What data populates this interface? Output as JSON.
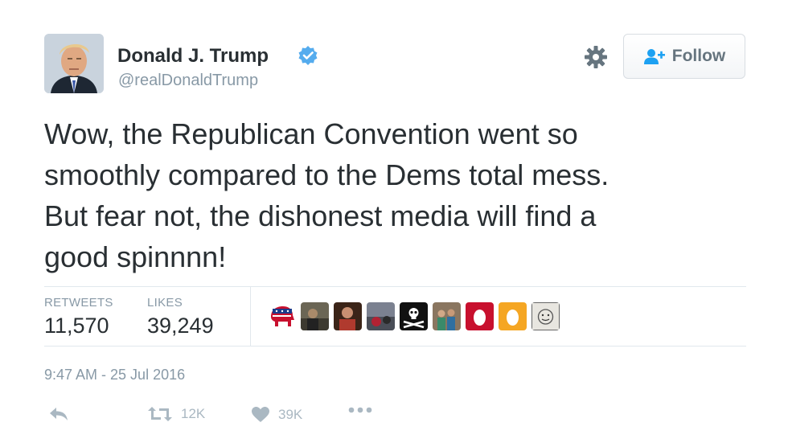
{
  "author": {
    "name": "Donald J. Trump",
    "handle": "@realDonaldTrump",
    "verified": true
  },
  "follow_button": {
    "label": "Follow"
  },
  "tweet": {
    "lines": [
      "Wow, the Republican Convention went so",
      "smoothly compared to the Dems total mess.",
      "But fear not, the dishonest media will find a",
      "good spinnnn!"
    ]
  },
  "stats": {
    "retweets_label": "RETWEETS",
    "retweets_count": "11,570",
    "likes_label": "LIKES",
    "likes_count": "39,249"
  },
  "liker_avatars": [
    "republican-elephant",
    "photo",
    "photo",
    "photo",
    "pirate-flag",
    "photo",
    "default-egg-red",
    "default-egg-orange",
    "sketch"
  ],
  "timestamp": "9:47 AM - 25 Jul 2016",
  "actions": {
    "retweet_count": "12K",
    "like_count": "39K"
  },
  "colors": {
    "text": "#292f33",
    "muted": "#8899a6",
    "verified_blue": "#55acee",
    "divider": "#e1e8ed"
  }
}
